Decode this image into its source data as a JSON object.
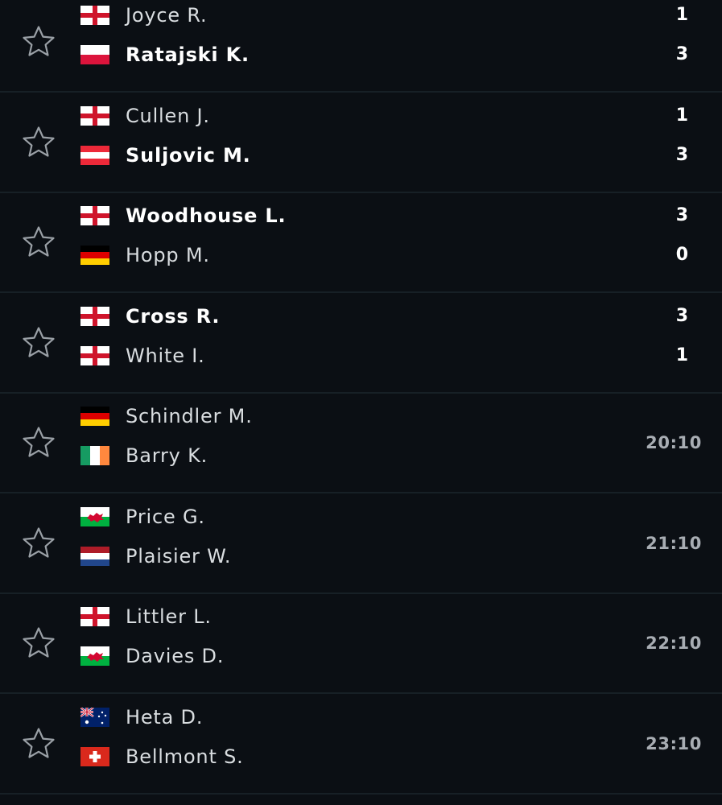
{
  "matches": [
    {
      "home": {
        "name": "Joyce R.",
        "flag": "england-flag",
        "winner": false
      },
      "away": {
        "name": "Ratajski K.",
        "flag": "poland-flag",
        "winner": true
      },
      "home_score": "1",
      "away_score": "3",
      "time": null
    },
    {
      "home": {
        "name": "Cullen J.",
        "flag": "england-flag",
        "winner": false
      },
      "away": {
        "name": "Suljovic M.",
        "flag": "austria-flag",
        "winner": true
      },
      "home_score": "1",
      "away_score": "3",
      "time": null
    },
    {
      "home": {
        "name": "Woodhouse L.",
        "flag": "england-flag",
        "winner": true
      },
      "away": {
        "name": "Hopp M.",
        "flag": "germany-flag",
        "winner": false
      },
      "home_score": "3",
      "away_score": "0",
      "time": null
    },
    {
      "home": {
        "name": "Cross R.",
        "flag": "england-flag",
        "winner": true
      },
      "away": {
        "name": "White I.",
        "flag": "england-flag",
        "winner": false
      },
      "home_score": "3",
      "away_score": "1",
      "time": null
    },
    {
      "home": {
        "name": "Schindler M.",
        "flag": "germany-flag",
        "winner": false
      },
      "away": {
        "name": "Barry K.",
        "flag": "ireland-flag",
        "winner": false
      },
      "home_score": null,
      "away_score": null,
      "time": "20:10"
    },
    {
      "home": {
        "name": "Price G.",
        "flag": "wales-flag",
        "winner": false
      },
      "away": {
        "name": "Plaisier W.",
        "flag": "netherlands-flag",
        "winner": false
      },
      "home_score": null,
      "away_score": null,
      "time": "21:10"
    },
    {
      "home": {
        "name": "Littler L.",
        "flag": "england-flag",
        "winner": false
      },
      "away": {
        "name": "Davies D.",
        "flag": "wales-flag",
        "winner": false
      },
      "home_score": null,
      "away_score": null,
      "time": "22:10"
    },
    {
      "home": {
        "name": "Heta D.",
        "flag": "australia-flag",
        "winner": false
      },
      "away": {
        "name": "Bellmont S.",
        "flag": "switzerland-flag",
        "winner": false
      },
      "home_score": null,
      "away_score": null,
      "time": "23:10"
    }
  ],
  "colors": {
    "background": "#0b0f14",
    "divider": "#172026",
    "loser_text": "#d9dde0",
    "winner_text": "#ffffff",
    "time_text": "#a8adb3",
    "star": "#9aa0a6"
  }
}
